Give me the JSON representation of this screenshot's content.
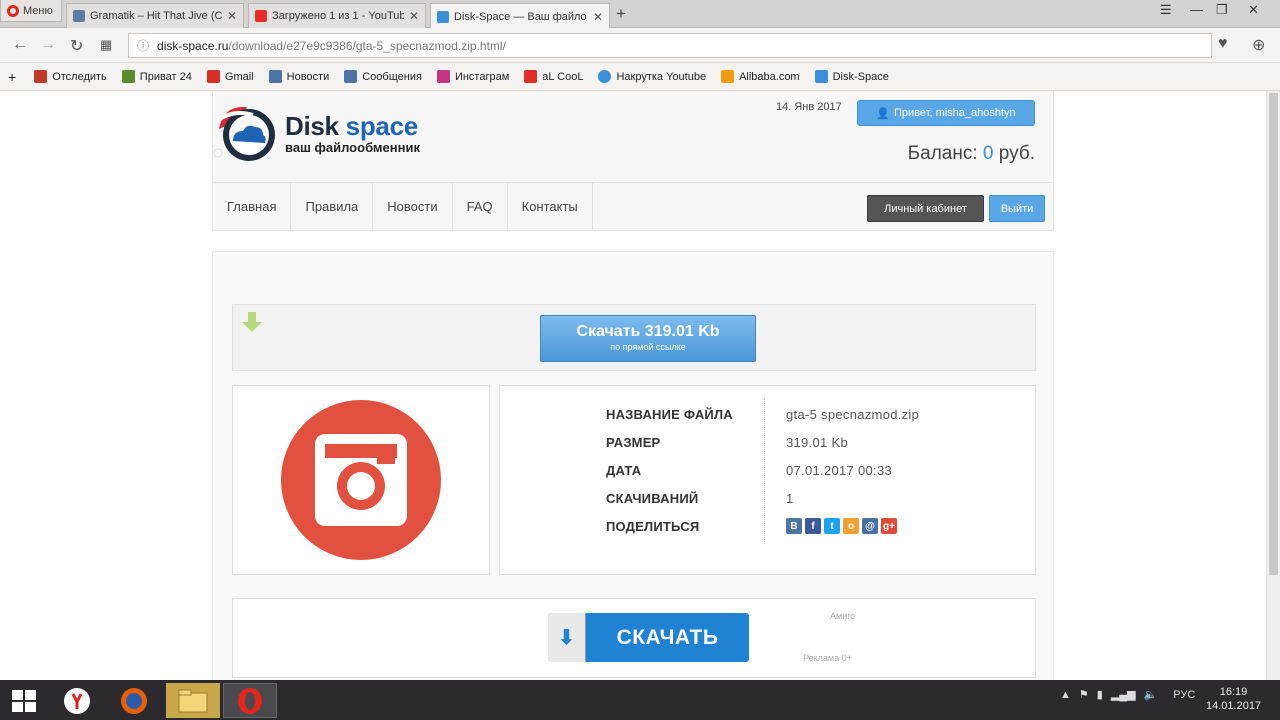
{
  "browser": {
    "menu_label": "Меню",
    "tabs": [
      {
        "title": "Gramatik – Hit That Jive (C",
        "color": "#5a7fa6"
      },
      {
        "title": "Загружено 1 из 1 - YouTub",
        "color": "#e52d27"
      },
      {
        "title": "Disk-Space — Ваш файло",
        "color": "#3a8fd9"
      }
    ],
    "url_host": "disk-space.ru",
    "url_path": "/download/e27e9c9386/gta-5_specnazmod.zip.html/",
    "bookmarks": [
      {
        "label": "Отследить",
        "icon": "track-icon",
        "color": "#c0392b"
      },
      {
        "label": "Приват 24",
        "icon": "privat-icon",
        "color": "#5b8c2a"
      },
      {
        "label": "Gmail",
        "icon": "gmail-icon",
        "color": "#d93025"
      },
      {
        "label": "Новости",
        "icon": "vk-icon",
        "color": "#4c75a3"
      },
      {
        "label": "Сообщения",
        "icon": "vk-icon",
        "color": "#4c75a3"
      },
      {
        "label": "Инстаграм",
        "icon": "instagram-icon",
        "color": "#c13584"
      },
      {
        "label": "aL CooL",
        "icon": "youtube-icon",
        "color": "#e52d27"
      },
      {
        "label": "Накрутка Youtube",
        "icon": "globe-icon",
        "color": "#3a8fd9"
      },
      {
        "label": "Alibaba.com",
        "icon": "alibaba-icon",
        "color": "#f39c12"
      },
      {
        "label": "Disk-Space",
        "icon": "disk-space-icon",
        "color": "#3a8fd9"
      }
    ]
  },
  "site": {
    "logo_disk": "Disk",
    "logo_space": "space",
    "logo_sub": "ваш файлообменник",
    "date": "14. Янв 2017",
    "greeting": "Привет, misha_ahoshtyn",
    "balance_label": "Баланс:",
    "balance_value": "0",
    "balance_currency": "руб.",
    "nav": [
      "Главная",
      "Правила",
      "Новости",
      "FAQ",
      "Контакты"
    ],
    "cabinet_button": "Личный кабинет",
    "logout_button": "Выйти"
  },
  "download": {
    "button_title": "Скачать 319.01 Kb",
    "button_sub": "по прямой ссылке",
    "file_icon": "instagram-icon",
    "rows": [
      {
        "key": "НАЗВАНИЕ ФАЙЛА",
        "value": "gta-5 specnazmod.zip"
      },
      {
        "key": "РАЗМЕР",
        "value": "319.01 Kb"
      },
      {
        "key": "ДАТА",
        "value": "07.01.2017 00:33"
      },
      {
        "key": "СКАЧИВАНИЙ",
        "value": "1"
      },
      {
        "key": "ПОДЕЛИТЬСЯ",
        "value": ""
      }
    ],
    "share": [
      {
        "label": "B",
        "icon": "vk-icon",
        "color": "#4c75a3"
      },
      {
        "label": "f",
        "icon": "facebook-icon",
        "color": "#3b5998"
      },
      {
        "label": "t",
        "icon": "twitter-icon",
        "color": "#1da1f2"
      },
      {
        "label": "o",
        "icon": "odnoklassniki-icon",
        "color": "#f2a035"
      },
      {
        "label": "@",
        "icon": "mailru-icon",
        "color": "#4a6fa5"
      },
      {
        "label": "g+",
        "icon": "googleplus-icon",
        "color": "#dd4b39"
      }
    ]
  },
  "ad": {
    "button_label": "СКАЧАТЬ",
    "text_top": "Амиго",
    "text_bottom": "Реклама 0+"
  },
  "taskbar": {
    "lang": "РУС",
    "time": "16:19",
    "date": "14.01.2017"
  }
}
